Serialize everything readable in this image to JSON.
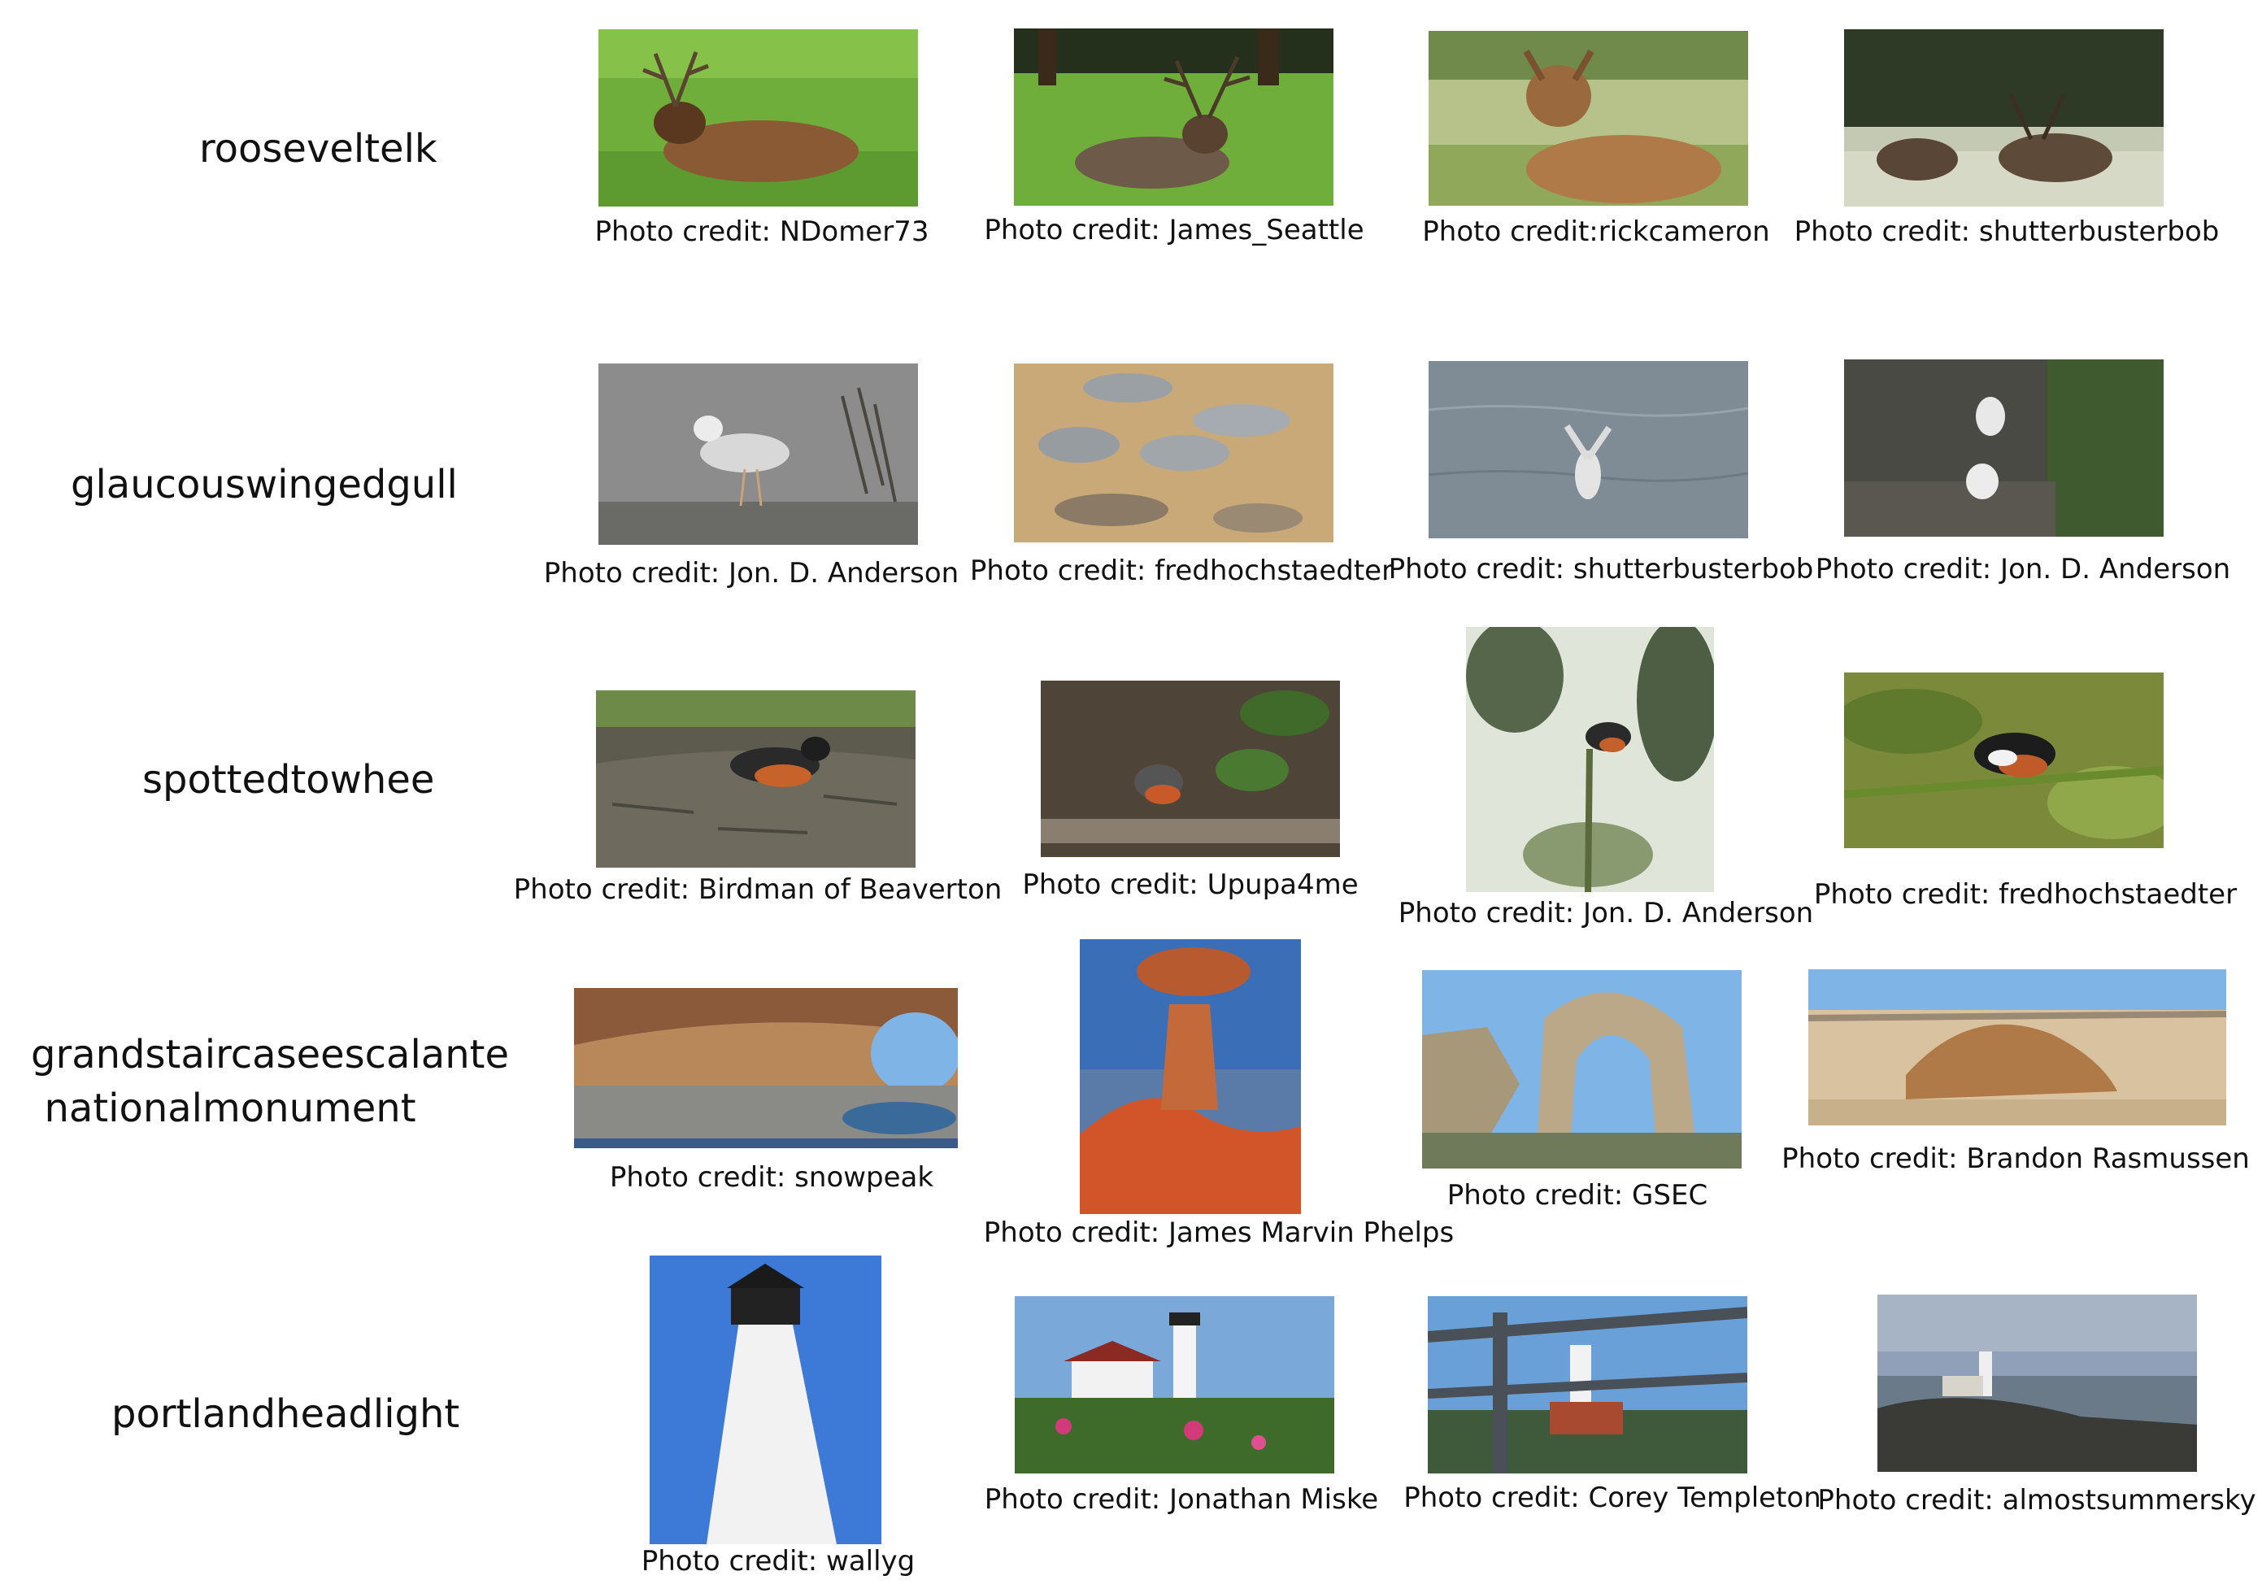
{
  "rows": [
    {
      "category": "rooseveltelk",
      "photos": [
        {
          "credit": "Photo credit: NDomer73",
          "icon": "elk-lying-in-grass-photo"
        },
        {
          "credit": "Photo credit: James_Seattle",
          "icon": "elk-resting-by-trees-photo"
        },
        {
          "credit": "Photo credit:rickcameron",
          "icon": "elk-in-tall-grass-photo"
        },
        {
          "credit": "Photo credit: shutterbusterbob",
          "icon": "elk-herd-at-forest-edge-photo"
        }
      ]
    },
    {
      "category": "glaucouswingedgull",
      "photos": [
        {
          "credit": "Photo credit: Jon. D. Anderson",
          "icon": "gull-standing-in-water-photo"
        },
        {
          "credit": "Photo credit: fredhochstaedter",
          "icon": "gull-flock-on-sand-photo"
        },
        {
          "credit": "Photo credit: shutterbusterbob",
          "icon": "gull-landing-on-water-photo"
        },
        {
          "credit": "Photo credit: Jon. D. Anderson",
          "icon": "gulls-on-rocky-cliff-photo"
        }
      ]
    },
    {
      "category": "spottedtowhee",
      "photos": [
        {
          "credit": "Photo credit: Birdman of Beaverton",
          "icon": "towhee-on-log-photo"
        },
        {
          "credit": "Photo credit: Upupa4me",
          "icon": "towhee-on-forest-floor-photo"
        },
        {
          "credit": "Photo credit: Jon. D. Anderson",
          "icon": "towhee-on-plant-photo"
        },
        {
          "credit": "Photo credit: fredhochstaedter",
          "icon": "towhee-in-leaves-photo"
        }
      ]
    },
    {
      "category_lines": [
        "grandstaircaseescalante",
        "nationalmonument"
      ],
      "photos": [
        {
          "credit": "Photo credit: snowpeak",
          "icon": "sandstone-alcove-photo"
        },
        {
          "credit": "Photo credit: James Marvin Phelps",
          "icon": "toadstool-hoodoo-photo"
        },
        {
          "credit": "Photo credit: GSEC",
          "icon": "rock-arch-photo"
        },
        {
          "credit": "Photo credit: Brandon Rasmussen",
          "icon": "slickrock-landscape-photo"
        }
      ]
    },
    {
      "category": "portlandheadlight",
      "photos": [
        {
          "credit": "Photo credit: wallyg",
          "icon": "lighthouse-tower-closeup-photo"
        },
        {
          "credit": "Photo credit: Jonathan Miske",
          "icon": "lighthouse-with-roses-photo"
        },
        {
          "credit": "Photo credit: Corey Templeton",
          "icon": "lighthouse-behind-fence-photo"
        },
        {
          "credit": "Photo credit: almostsummersky",
          "icon": "lighthouse-at-dusk-photo"
        }
      ]
    }
  ],
  "colors": {
    "grass": "#6fae3a",
    "sky": "#7fb4e6",
    "sand": "#c9a978",
    "water": "#7f8c95",
    "rock": "#b8875a",
    "elk": "#8a5a34"
  }
}
